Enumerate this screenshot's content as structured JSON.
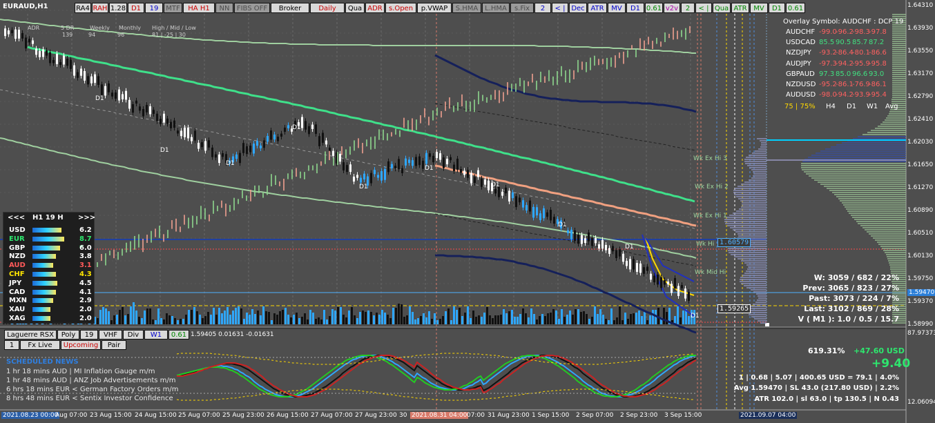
{
  "symbol": "EURAUD,H1",
  "toolbar": [
    {
      "label": "RA4",
      "bg": "#d9d9d9",
      "fg": "#000000"
    },
    {
      "label": "RAH",
      "bg": "#d9d9d9",
      "fg": "#cc0000"
    },
    {
      "label": "1.28",
      "bg": "#d9d9d9",
      "fg": "#000000"
    },
    {
      "label": "D1",
      "bg": "#d9d9d9",
      "fg": "#cc0000"
    },
    {
      "label": "19",
      "bg": "#d9d9d9",
      "fg": "#0000cc"
    },
    {
      "label": "MTF",
      "bg": "#9a9a9a",
      "fg": "#4d4d4d"
    },
    {
      "label": "HA H1",
      "bg": "#d9d9d9",
      "fg": "#cc0000"
    },
    {
      "label": "NN",
      "bg": "#9a9a9a",
      "fg": "#4d4d4d"
    },
    {
      "label": "FIBS OFF",
      "bg": "#9a9a9a",
      "fg": "#4d4d4d"
    },
    {
      "label": "Broker",
      "bg": "#d9d9d9",
      "fg": "#000000"
    },
    {
      "label": "Daily",
      "bg": "#d9d9d9",
      "fg": "#cc0000"
    },
    {
      "label": "Qua",
      "bg": "#d9d9d9",
      "fg": "#000000"
    },
    {
      "label": "ADR",
      "bg": "#d9d9d9",
      "fg": "#cc0000"
    },
    {
      "label": "s.Open",
      "bg": "#d9d9d9",
      "fg": "#cc0000"
    },
    {
      "label": "p.VWAP",
      "bg": "#d9d9d9",
      "fg": "#000000"
    },
    {
      "label": "S.HMA",
      "bg": "#9a9a9a",
      "fg": "#4d4d4d"
    },
    {
      "label": "L.HMA",
      "bg": "#9a9a9a",
      "fg": "#4d4d4d"
    },
    {
      "label": "s.Fix",
      "bg": "#9a9a9a",
      "fg": "#4d4d4d"
    },
    {
      "label": "2",
      "bg": "#d9d9d9",
      "fg": "#0000cc"
    },
    {
      "label": "< |",
      "bg": "#d9d9d9",
      "fg": "#0000cc"
    },
    {
      "label": "Dec",
      "bg": "#d9d9d9",
      "fg": "#0000cc"
    },
    {
      "label": "ATR",
      "bg": "#d9d9d9",
      "fg": "#0000cc"
    },
    {
      "label": "MV",
      "bg": "#d9d9d9",
      "fg": "#0000cc"
    },
    {
      "label": "D1",
      "bg": "#d9d9d9",
      "fg": "#0000cc"
    },
    {
      "label": "0.61",
      "bg": "#d9d9d9",
      "fg": "#008800"
    },
    {
      "label": "v2v",
      "bg": "#d9d9d9",
      "fg": "#aa00aa"
    },
    {
      "label": "2",
      "bg": "#d9d9d9",
      "fg": "#008800"
    },
    {
      "label": "< |",
      "bg": "#d9d9d9",
      "fg": "#008800"
    },
    {
      "label": "Qua",
      "bg": "#d9d9d9",
      "fg": "#008800"
    },
    {
      "label": "ATR",
      "bg": "#d9d9d9",
      "fg": "#008800"
    },
    {
      "label": "MV",
      "bg": "#d9d9d9",
      "fg": "#008800"
    },
    {
      "label": "D1",
      "bg": "#d9d9d9",
      "fg": "#008800"
    },
    {
      "label": "0.61",
      "bg": "#d9d9d9",
      "fg": "#008800"
    }
  ],
  "header_stats": {
    "labels": [
      "ADR",
      "5 DR",
      "Weekly",
      "Monthly",
      "High / Mid / Low"
    ],
    "values": [
      "139",
      "94",
      "96",
      "81  |  -25  |  30"
    ]
  },
  "price_axis": [
    "1.64310",
    "1.63930",
    "1.63550",
    "1.63170",
    "1.62790",
    "1.62410",
    "1.62030",
    "1.61650",
    "1.61270",
    "1.60890",
    "1.60510",
    "1.60130",
    "1.59750",
    "1.59370",
    "1.58990"
  ],
  "price_current": "1.59470",
  "osc_axis": [
    "87.97373",
    "12.06094"
  ],
  "time_axis": [
    "2021.08.23 00:00",
    "Aug 07:00",
    "23 Aug 15:00",
    "24 Aug 15:00",
    "25 Aug 07:00",
    "25 Aug 23:00",
    "26 Aug 15:00",
    "27 Aug 07:00",
    "27 Aug 23:00",
    "30",
    "2021.08.31 04:00",
    "07:00",
    "31 Aug 23:00",
    "1 Sep 15:00",
    "2 Sep 07:00",
    "2 Sep 23:00",
    "3 Sep 15:00",
    "2021.09.07 04:00"
  ],
  "strength_panel": {
    "header": [
      "<<<",
      "H1  19  H",
      ">>>"
    ],
    "rows": [
      {
        "ccy": "USD",
        "val": "6.2",
        "color": "#ffffff"
      },
      {
        "ccy": "EUR",
        "val": "8.7 *",
        "color": "#2ee66e"
      },
      {
        "ccy": "GBP",
        "val": "6.0",
        "color": "#ffffff"
      },
      {
        "ccy": "NZD",
        "val": "3.8",
        "color": "#ffffff"
      },
      {
        "ccy": "AUD",
        "val": "3.1",
        "color": "#ff5a5a"
      },
      {
        "ccy": "CHF",
        "val": "4.3",
        "color": "#ffe600"
      },
      {
        "ccy": "JPY",
        "val": "4.5",
        "color": "#ffffff"
      },
      {
        "ccy": "CAD",
        "val": "4.1",
        "color": "#ffffff"
      },
      {
        "ccy": "MXN",
        "val": "2.9",
        "color": "#ffffff"
      },
      {
        "ccy": "XAU",
        "val": "2.0",
        "color": "#ffffff"
      },
      {
        "ccy": "XAG",
        "val": "2.0",
        "color": "#ffffff"
      }
    ]
  },
  "overlay": {
    "title": "Overlay Symbol: AUDCHF : DCP 19",
    "rows": [
      {
        "pair": "AUDCHF",
        "v": [
          "-99.0",
          "-96.2",
          "-98.3",
          "-97.8"
        ],
        "col": [
          "#ff6060",
          "#ff6060",
          "#ff6060",
          "#ff6060"
        ]
      },
      {
        "pair": "USDCAD",
        "v": [
          "85.5",
          "90.5",
          "85.7",
          "87.2"
        ],
        "col": [
          "#40e080",
          "#40e080",
          "#40e080",
          "#40e080"
        ]
      },
      {
        "pair": "NZDJPY",
        "v": [
          "-93.2",
          "-86.4",
          "-80.1",
          "-86.6"
        ],
        "col": [
          "#ff6060",
          "#ff6060",
          "#ff6060",
          "#ff6060"
        ]
      },
      {
        "pair": "AUDJPY",
        "v": [
          "-97.3",
          "-94.2",
          "-95.9",
          "-95.8"
        ],
        "col": [
          "#ff6060",
          "#ff6060",
          "#ff6060",
          "#ff6060"
        ]
      },
      {
        "pair": "GBPAUD",
        "v": [
          "97.3",
          "85.0",
          "96.6",
          "93.0"
        ],
        "col": [
          "#40e080",
          "#40e080",
          "#40e080",
          "#40e080"
        ]
      },
      {
        "pair": "NZDUSD",
        "v": [
          "-95.2",
          "-86.1",
          "-76.9",
          "-86.1"
        ],
        "col": [
          "#ff6060",
          "#ff6060",
          "#ff6060",
          "#ff6060"
        ]
      },
      {
        "pair": "AUDUSD",
        "v": [
          "-98.0",
          "-94.2",
          "-93.9",
          "-95.4"
        ],
        "col": [
          "#ff6060",
          "#ff6060",
          "#ff6060",
          "#ff6060"
        ]
      }
    ],
    "footer": [
      "75 | 75%",
      "H4",
      "D1",
      "W1",
      "Avg"
    ]
  },
  "stats": [
    "W: 3059 / 682 / 22%",
    "Prev: 3065 / 823 / 27%",
    "Past: 3073 / 224 / 7%",
    "Last: 3102 / 869 / 28%",
    "V ( M1 ): 1.0 / 0.5 / 15.7"
  ],
  "level_labels": [
    "Wk Ex Hi 3",
    "Wk Ex Hi 2",
    "Wk Ex Hi 1",
    "Wk Hi",
    "Wk Mid Hi"
  ],
  "price_boxes": [
    "1.60579",
    "1.59265"
  ],
  "d1_labels": [
    "D1",
    "D1",
    "D1",
    "D1",
    "D1",
    "D1",
    "D1",
    "D1",
    "D1",
    "D1"
  ],
  "sub_toolbar": [
    {
      "label": "Laguerre RSX",
      "fg": "#000000"
    },
    {
      "label": "Poly",
      "fg": "#000000"
    },
    {
      "label": "19",
      "fg": "#000000"
    },
    {
      "label": "VHF",
      "fg": "#000000"
    },
    {
      "label": "Div",
      "fg": "#000000"
    },
    {
      "label": "W1",
      "fg": "#0000cc"
    },
    {
      "label": "0.61",
      "fg": "#008800"
    }
  ],
  "sub_info": "1.59405  0.01631  -0.01631",
  "sub_toolbar2": [
    {
      "label": "1",
      "fg": "#000000"
    },
    {
      "label": "Fx Live",
      "fg": "#000000"
    },
    {
      "label": "Upcoming",
      "fg": "#cc0000"
    },
    {
      "label": "Pair",
      "fg": "#000000"
    }
  ],
  "news": {
    "title": "SCHEDULED NEWS",
    "items": [
      "1 hr 18 mins  AUD  |  MI Inflation Gauge m/m",
      "1 hr 48 mins  AUD  |  ANZ Job Advertisements m/m",
      "6 hrs 18 mins  EUR  <  German Factory Orders m/m",
      "8 hrs 48 mins  EUR  <  Sentix Investor Confidence"
    ]
  },
  "bottom_stats": {
    "pct": "619.31%",
    "usd": "+47.60 USD",
    "big": "+9.40",
    "line1": "1  |  0.68  |  5.07  |  400.65 USD = 79.1  |  4.0%",
    "line2": "Avg 1.59470  |  SL 43.0 (217.80 USD)  |  2.2%",
    "line3": "ATR 102.0  |  sl 63.0  |  tp 130.5  |  N 0.43"
  }
}
